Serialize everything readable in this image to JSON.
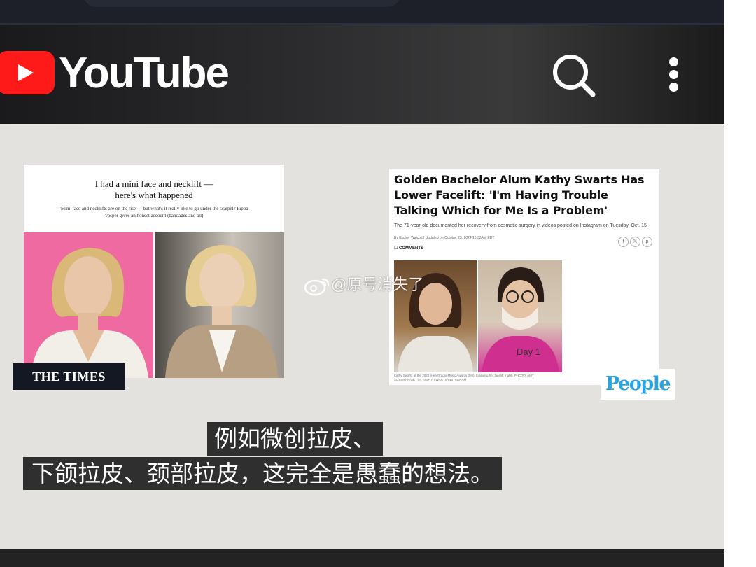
{
  "app": {
    "brand": "YouTube"
  },
  "times_article": {
    "headline_line1": "I had a mini face and necklift —",
    "headline_line2": "here's what happened",
    "subhead": "'Mini' face and necklifts are on the rise — but what's it really like to go under the scalpel? Pippa Vosper gives an honest account (bandages and all)",
    "publisher": "THE TIMES"
  },
  "people_article": {
    "headline": "Golden Bachelor Alum Kathy Swarts Has Lower Facelift: 'I'm Having Trouble Talking Which for Me Is a Problem'",
    "dek": "The 71-year-old documented her recovery from cosmetic surgery in videos posted on Instagram on Tuesday, Oct. 15",
    "byline": "By Escher Walcott | Updated on October 23, 2024 10:33AM EDT",
    "comments": "COMMENTS",
    "photo_label": "Day 1",
    "caption": "Kathy Swarts at the 2024 iHeartRadio Music Awards (left); following her facelift (right). PHOTO: AMY SUSSMAN/GETTY; KATHY SWARTS/INSTAGRAM",
    "publisher": "People"
  },
  "watermark": "@原号消失了",
  "subtitles": {
    "line1": "例如微创拉皮、",
    "line2": "下颌拉皮、颈部拉皮，这完全是愚蠢的想法。"
  },
  "colors": {
    "youtube_red": "#ff1a1a",
    "video_bg": "#e4e2de",
    "people_blue": "#29a4e0",
    "subtitle_bg": "#2f2f2f"
  }
}
